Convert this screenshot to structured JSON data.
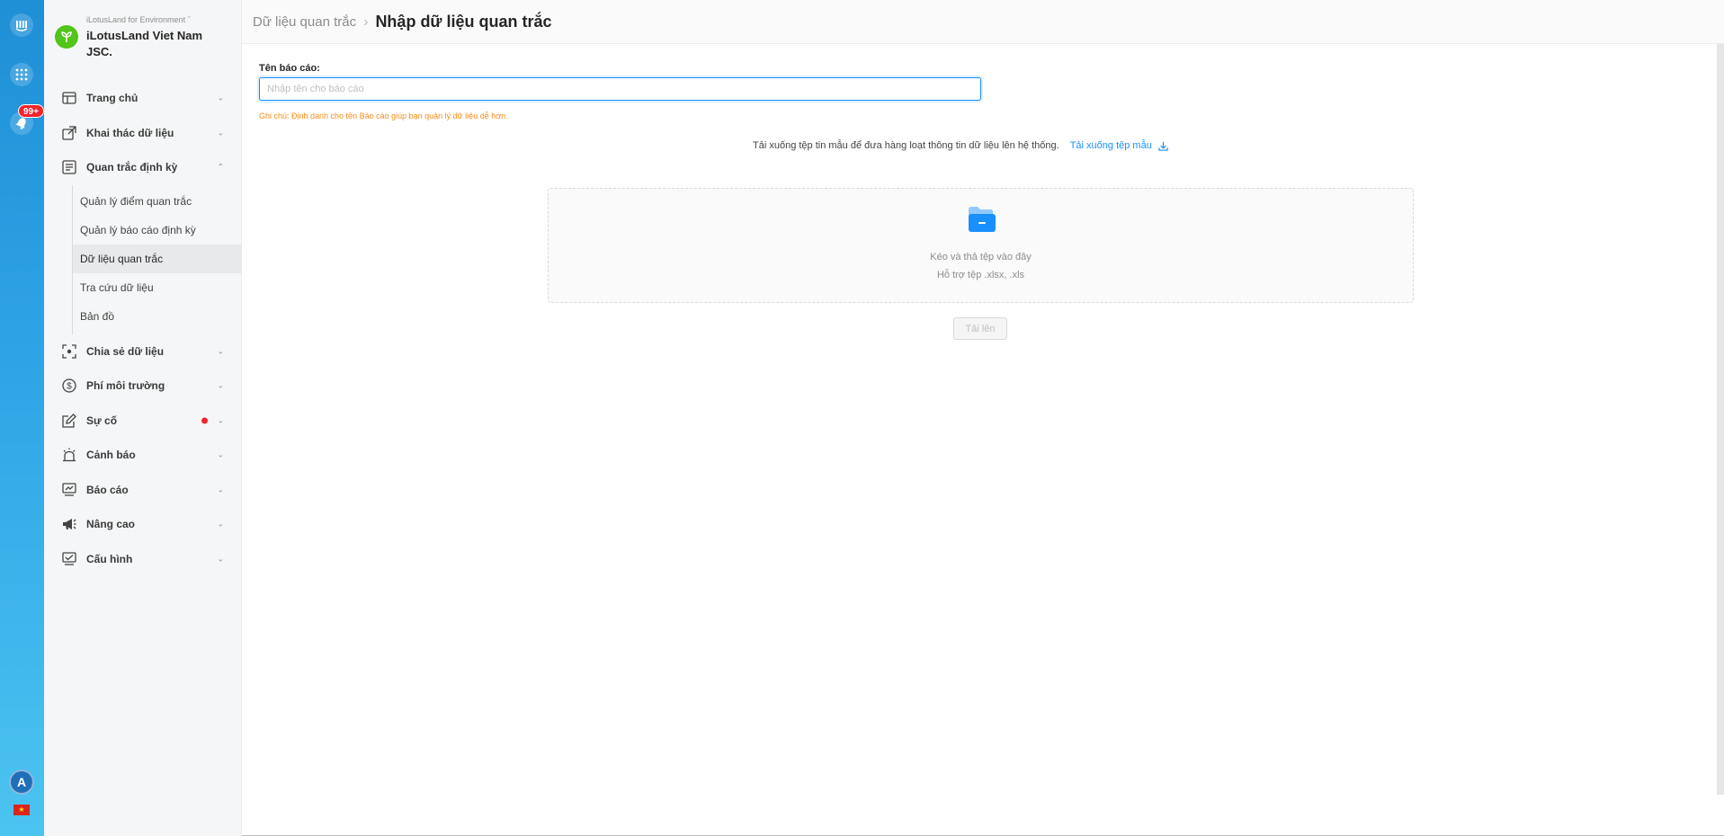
{
  "rail": {
    "badge": "99+",
    "avatar_letter": "A",
    "flag": "★"
  },
  "org": {
    "subtitle": "iLotusLand for Environment",
    "name": "iLotusLand Viet Nam JSC."
  },
  "menu": {
    "items": [
      {
        "label": "Trang chủ",
        "icon": "home-layout-icon"
      },
      {
        "label": "Khai thác dữ liệu",
        "icon": "external-link-icon"
      },
      {
        "label": "Quan trắc định kỳ",
        "icon": "document-list-icon",
        "expanded": true
      }
    ],
    "submenu": [
      {
        "label": "Quản lý điểm quan trắc"
      },
      {
        "label": "Quản lý báo cáo định kỳ"
      },
      {
        "label": "Dữ liệu quan trắc",
        "active": true
      },
      {
        "label": "Tra cứu dữ liệu"
      },
      {
        "label": "Bản đồ"
      }
    ],
    "items_after": [
      {
        "label": "Chia sẻ dữ liệu",
        "icon": "share-focus-icon"
      },
      {
        "label": "Phí môi trường",
        "icon": "dollar-circle-icon"
      },
      {
        "label": "Sự cố",
        "icon": "edit-icon",
        "dot": true
      },
      {
        "label": "Cảnh báo",
        "icon": "alarm-icon"
      },
      {
        "label": "Báo cáo",
        "icon": "monitor-chart-icon"
      },
      {
        "label": "Nâng cao",
        "icon": "megaphone-icon"
      },
      {
        "label": "Cấu hình",
        "icon": "monitor-settings-icon"
      }
    ]
  },
  "header": {
    "breadcrumb_parent": "Dữ liệu quan trắc",
    "title": "Nhập dữ liệu quan trắc"
  },
  "form": {
    "label": "Tên báo cáo:",
    "placeholder": "Nhập tên cho báo cáo",
    "value": "",
    "note": "Ghi chú: Định danh cho tên Báo cáo giúp bạn quản lý dữ liệu dễ hơn."
  },
  "download": {
    "text": "Tải xuống tệp tin mẫu để đưa hàng loạt thông tin dữ liệu lên hệ thống.",
    "link": "Tải xuống tệp mẫu"
  },
  "dropzone": {
    "title": "Kéo và thả tệp vào đây",
    "hint": "Hỗ trợ tệp .xlsx, .xls"
  },
  "upload_button": "Tải lên",
  "colors": {
    "accent": "#1890ff",
    "note": "#fa8c16",
    "badge": "#f5222d",
    "org_logo": "#52c41a"
  }
}
